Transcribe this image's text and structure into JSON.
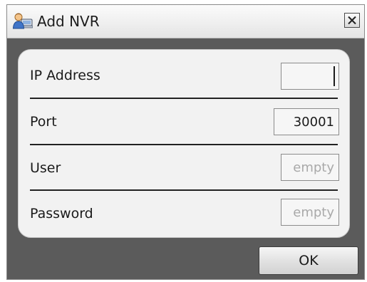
{
  "dialog": {
    "title": "Add NVR",
    "app_icon": "user-network-icon",
    "close_icon": "close-icon"
  },
  "form": {
    "ip_address": {
      "label": "IP Address",
      "value": "",
      "placeholder": ""
    },
    "port": {
      "label": "Port",
      "value": "30001",
      "placeholder": ""
    },
    "user": {
      "label": "User",
      "value": "",
      "placeholder": "empty"
    },
    "password": {
      "label": "Password",
      "value": "",
      "placeholder": "empty"
    }
  },
  "actions": {
    "ok_label": "OK"
  },
  "colors": {
    "content_background": "#5b5b5b",
    "panel_background": "#f2f2f2",
    "divider": "#222222",
    "placeholder_text": "#a9a9a9"
  }
}
